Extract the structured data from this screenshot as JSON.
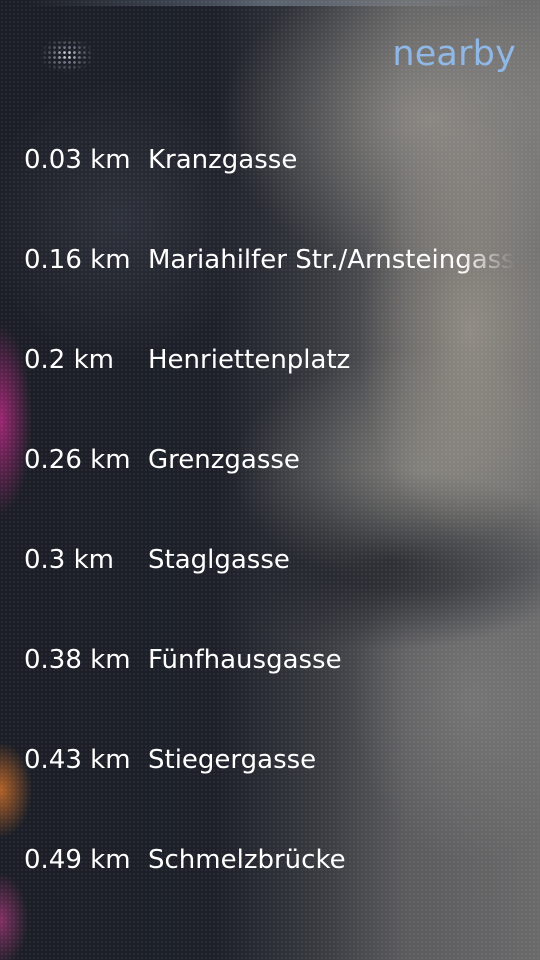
{
  "header": {
    "title": "nearby"
  },
  "stops": [
    {
      "distance": "0.03 km",
      "name": "Kranzgasse"
    },
    {
      "distance": "0.16 km",
      "name": "Mariahilfer Str./Arnsteingasse"
    },
    {
      "distance": "0.2 km",
      "name": "Henriettenplatz"
    },
    {
      "distance": "0.26 km",
      "name": "Grenzgasse"
    },
    {
      "distance": "0.3 km",
      "name": "Staglgasse"
    },
    {
      "distance": "0.38 km",
      "name": "Fünfhausgasse"
    },
    {
      "distance": "0.43 km",
      "name": "Stiegergasse"
    },
    {
      "distance": "0.49 km",
      "name": "Schmelzbrücke"
    }
  ],
  "colors": {
    "header": "#8fb8e6",
    "text": "#ffffff"
  }
}
